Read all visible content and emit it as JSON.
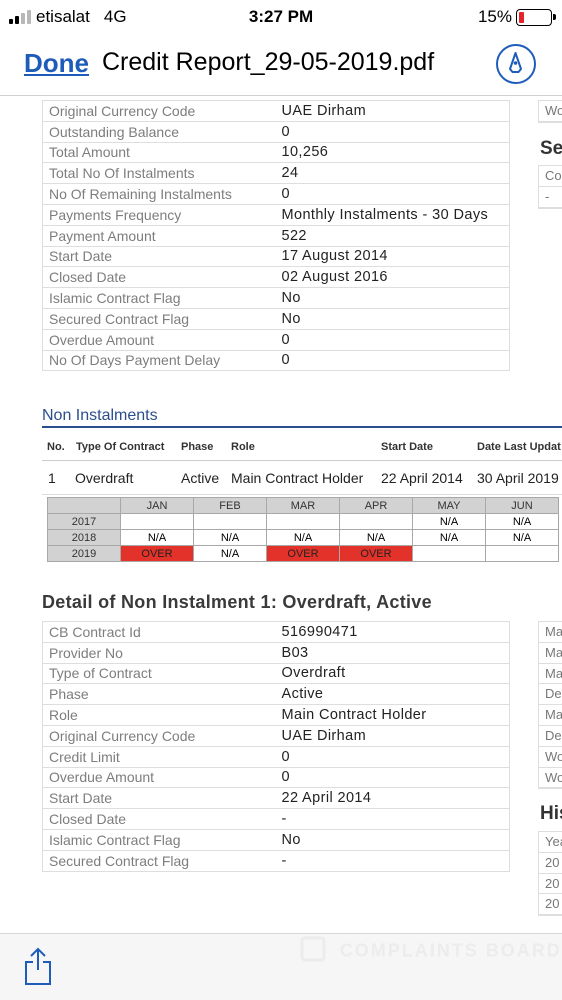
{
  "status_bar": {
    "carrier": "etisalat",
    "network": "4G",
    "time": "3:27 PM",
    "battery": "15%",
    "battery_level": 0.15,
    "battery_color": "#e3242b"
  },
  "nav": {
    "done_label": "Done",
    "title": "Credit Report_29-05-2019.pdf"
  },
  "instalment_details": [
    {
      "label": "Original Currency Code",
      "value": "UAE Dirham"
    },
    {
      "label": "Outstanding Balance",
      "value": "0"
    },
    {
      "label": "Total Amount",
      "value": "10,256"
    },
    {
      "label": "Total No Of Instalments",
      "value": "24"
    },
    {
      "label": "No Of Remaining Instalments",
      "value": "0"
    },
    {
      "label": "Payments Frequency",
      "value": "Monthly Instalments - 30 Days"
    },
    {
      "label": "Payment Amount",
      "value": "522"
    },
    {
      "label": "Start Date",
      "value": "17 August 2014"
    },
    {
      "label": "Closed Date",
      "value": "02 August 2016"
    },
    {
      "label": "Islamic Contract Flag",
      "value": "No"
    },
    {
      "label": "Secured Contract Flag",
      "value": "No"
    },
    {
      "label": "Overdue Amount",
      "value": "0"
    },
    {
      "label": "No Of Days Payment Delay",
      "value": "0"
    }
  ],
  "non_instalments": {
    "title": "Non Instalments",
    "headers": {
      "no": "No.",
      "type": "Type Of Contract",
      "phase": "Phase",
      "role": "Role",
      "start": "Start Date",
      "last_update": "Date Last Updat"
    },
    "row": {
      "no": "1",
      "type": "Overdraft",
      "phase": "Active",
      "role": "Main Contract Holder",
      "start": "22 April 2014",
      "last_update": "30 April 2019"
    }
  },
  "payment_grid": {
    "months": [
      "JAN",
      "FEB",
      "MAR",
      "APR",
      "MAY",
      "JUN"
    ],
    "rows": [
      {
        "year": "2017",
        "cells": [
          "",
          "",
          "",
          "",
          "N/A",
          "N/A"
        ]
      },
      {
        "year": "2018",
        "cells": [
          "N/A",
          "N/A",
          "N/A",
          "N/A",
          "N/A",
          "N/A"
        ]
      },
      {
        "year": "2019",
        "cells": [
          "OVER",
          "N/A",
          "OVER",
          "OVER",
          "",
          ""
        ]
      }
    ],
    "over_color": "#e2322a"
  },
  "detail": {
    "title": "Detail of Non Instalment 1: Overdraft, Active",
    "rows": [
      {
        "label": "CB Contract Id",
        "value": "516990471"
      },
      {
        "label": "Provider No",
        "value": "B03"
      },
      {
        "label": "Type of Contract",
        "value": "Overdraft"
      },
      {
        "label": "Phase",
        "value": "Active"
      },
      {
        "label": "Role",
        "value": "Main Contract Holder"
      },
      {
        "label": "Original Currency Code",
        "value": "UAE Dirham"
      },
      {
        "label": "Credit Limit",
        "value": "0"
      },
      {
        "label": "Overdue Amount",
        "value": "0"
      },
      {
        "label": "Start Date",
        "value": "22 April 2014"
      },
      {
        "label": "Closed Date",
        "value": "-"
      },
      {
        "label": "Islamic Contract Flag",
        "value": "No"
      },
      {
        "label": "Secured Contract Flag",
        "value": "-"
      }
    ]
  },
  "right_column": {
    "top_label": "Wo",
    "section_title": "Se",
    "table_cells": [
      "Co",
      "-"
    ],
    "detail_cells": [
      "Ma",
      "Ma",
      "Ma",
      "De",
      "Ma",
      "De",
      "Wo",
      "Wo"
    ],
    "history_title": "His",
    "history_cells": [
      "Yea",
      "20",
      "20",
      "20"
    ]
  },
  "watermark": "COMPLAINTS BOARD",
  "accent_color": "#1e5cba"
}
